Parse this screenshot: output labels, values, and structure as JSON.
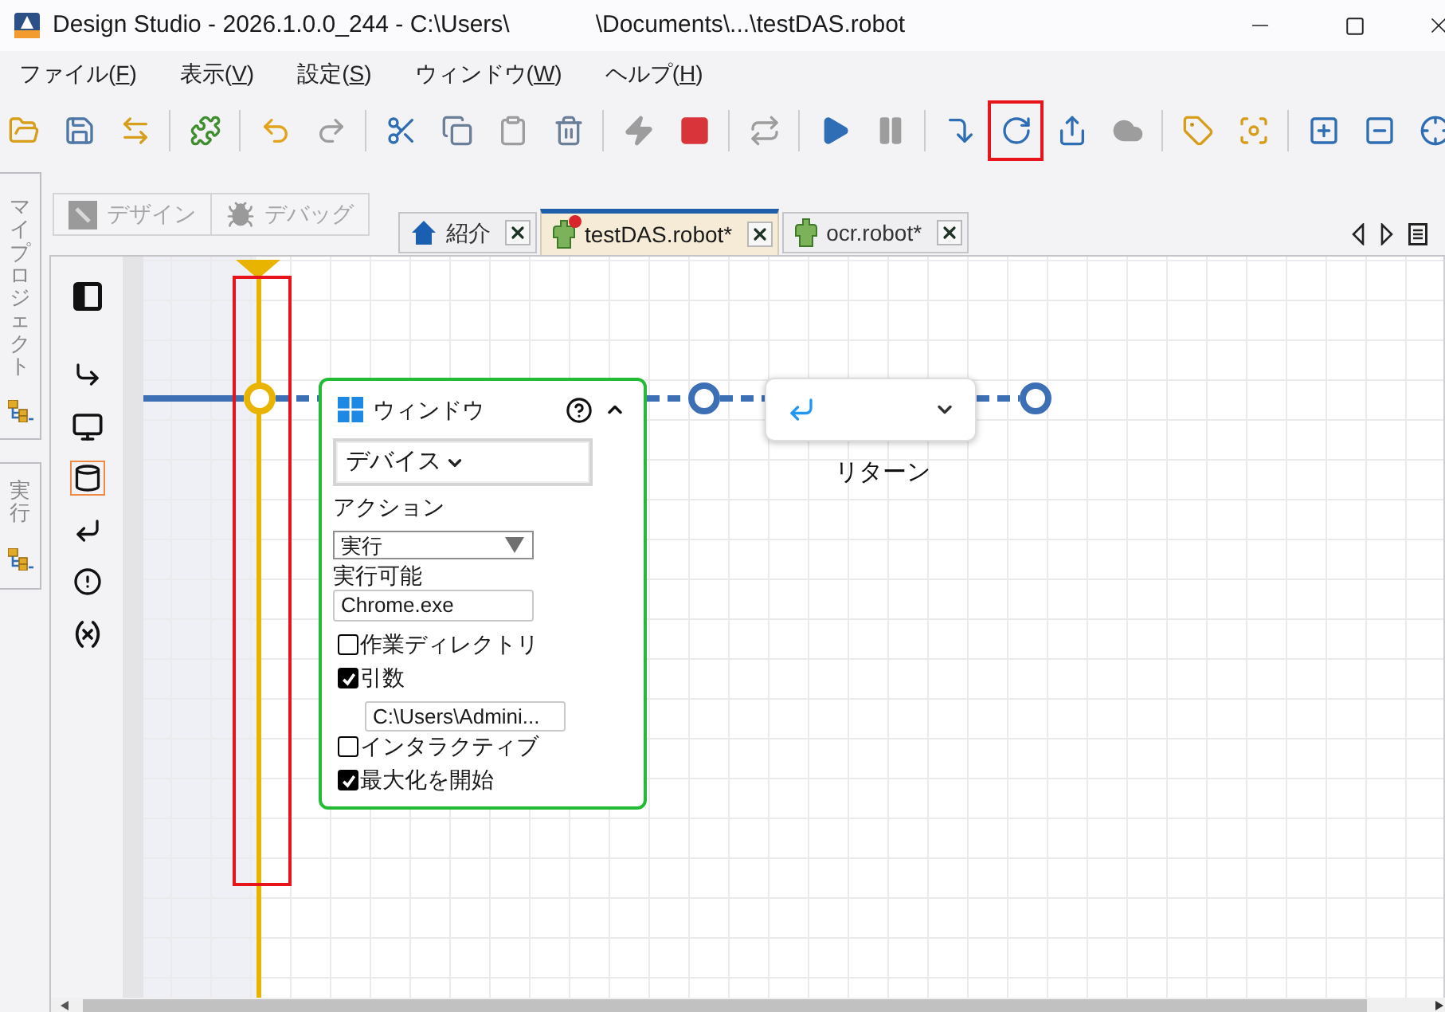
{
  "window": {
    "title_parts": [
      "Design Studio - 2026.1.0.0_244 - C:\\Users\\",
      "\\Documents\\...\\testDAS.robot"
    ]
  },
  "menu": [
    {
      "label": "ファイル(",
      "mnemonic": "F",
      "suffix": ")"
    },
    {
      "label": "表示(",
      "mnemonic": "V",
      "suffix": ")"
    },
    {
      "label": "設定(",
      "mnemonic": "S",
      "suffix": ")"
    },
    {
      "label": "ウィンドウ(",
      "mnemonic": "W",
      "suffix": ")"
    },
    {
      "label": "ヘルプ(",
      "mnemonic": "H",
      "suffix": ")"
    }
  ],
  "toolbar": {
    "groups": [
      [
        {
          "disabled": false,
          "highlighted": false
        },
        {
          "disabled": false,
          "highlighted": false
        },
        {
          "disabled": false,
          "highlighted": false
        }
      ],
      [
        {
          "disabled": false,
          "highlighted": false
        }
      ],
      [
        {
          "disabled": false,
          "highlighted": false
        },
        {
          "disabled": true,
          "highlighted": false
        }
      ],
      [
        {
          "disabled": false,
          "highlighted": false
        },
        {
          "disabled": false,
          "highlighted": false
        },
        {
          "disabled": true,
          "highlighted": false
        },
        {
          "disabled": false,
          "highlighted": false
        }
      ],
      [
        {
          "disabled": true,
          "highlighted": false
        },
        {
          "disabled": false,
          "highlighted": false
        }
      ],
      [
        {
          "disabled": true,
          "highlighted": false
        }
      ],
      [
        {
          "disabled": false,
          "highlighted": false
        },
        {
          "disabled": true,
          "highlighted": false
        }
      ],
      [
        {
          "disabled": false,
          "highlighted": false
        },
        {
          "disabled": false,
          "highlighted": true
        },
        {
          "disabled": false,
          "highlighted": false
        },
        {
          "disabled": true,
          "highlighted": false
        }
      ],
      [
        {
          "disabled": false,
          "highlighted": false
        },
        {
          "disabled": false,
          "highlighted": false
        }
      ],
      [
        {
          "disabled": false,
          "highlighted": false
        },
        {
          "disabled": false,
          "highlighted": false
        },
        {
          "disabled": false,
          "highlighted": false
        }
      ]
    ]
  },
  "side_tabs": [
    {
      "label": "マイプロジェクト"
    },
    {
      "label": "実行"
    }
  ],
  "mode_buttons": [
    {
      "label": "デザイン",
      "disabled": true
    },
    {
      "label": "デバッグ",
      "disabled": true
    }
  ],
  "doc_tabs": [
    {
      "kind": "home",
      "label": "紹介",
      "selected": false,
      "marker": false
    },
    {
      "kind": "robot",
      "label": "testDAS.robot*",
      "selected": true,
      "marker": true
    },
    {
      "kind": "robot",
      "label": "ocr.robot*",
      "selected": false,
      "marker": false
    }
  ],
  "palette": [
    {
      "selected": false
    },
    {
      "selected": false
    },
    {
      "selected": false
    },
    {
      "selected": true
    },
    {
      "selected": false
    },
    {
      "selected": false
    },
    {
      "selected": false
    }
  ],
  "canvas": {
    "cursor": {
      "highlighted": true
    },
    "window_step": {
      "title": "ウィンドウ",
      "expanded": true,
      "device": "デバイス",
      "fields": [
        {
          "kind": "select",
          "label": "アクション",
          "value": "実行"
        },
        {
          "kind": "input",
          "label": "実行可能",
          "value": "Chrome.exe"
        },
        {
          "kind": "checkbox",
          "label": "作業ディレクトリ",
          "checked": false
        },
        {
          "kind": "checkbox",
          "label": "引数",
          "checked": true,
          "value": "C:\\Users\\Admini..."
        },
        {
          "kind": "checkbox",
          "label": "インタラクティブ",
          "checked": false
        },
        {
          "kind": "checkbox",
          "label": "最大化を開始",
          "checked": true
        }
      ]
    },
    "return_step": {
      "label": "リターン",
      "expanded": false
    }
  }
}
